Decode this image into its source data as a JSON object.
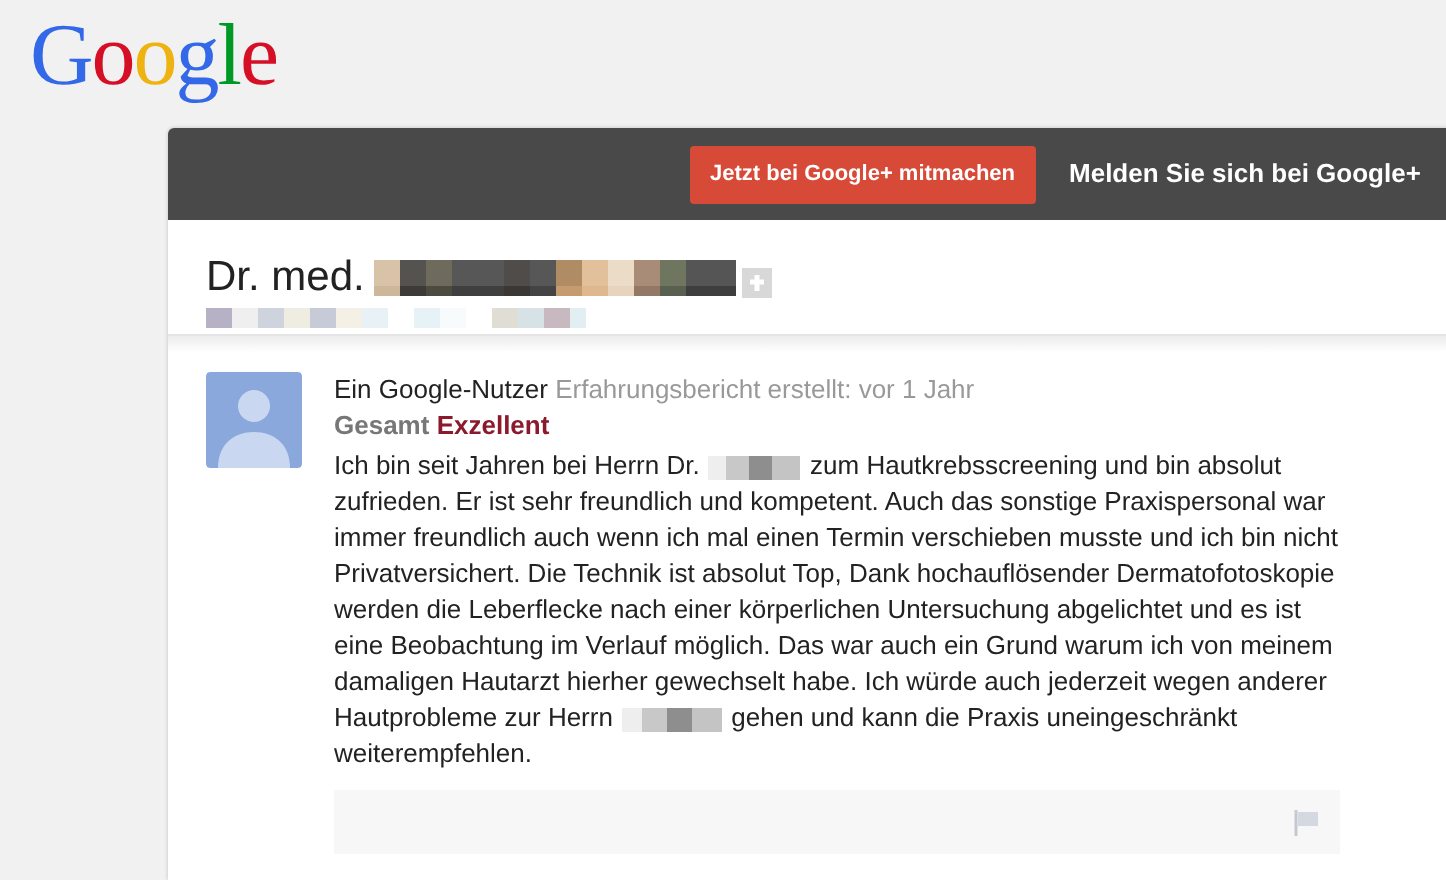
{
  "logo": "Google",
  "top_bar": {
    "join_button": "Jetzt bei Google+ mitmachen",
    "sign_in": "Melden Sie sich bei Google+"
  },
  "place": {
    "name": "Dr. med."
  },
  "review": {
    "author": "Ein Google-Nutzer",
    "meta": "Erfahrungsbericht erstellt: vor 1 Jahr",
    "rating_label": "Gesamt",
    "rating": "Exzellent",
    "text_parts": [
      "Ich bin seit Jahren bei Herrn Dr. ",
      " zum Hautkrebsscreening und bin absolut zufrieden. Er ist sehr freundlich und kompetent. Auch das sonstige Praxispersonal war immer freundlich auch wenn ich mal einen Termin verschieben musste und ich bin nicht Privatversichert. Die Technik ist absolut Top, Dank hochauflösender Dermatofotoskopie werden die Leberflecke nach einer körperlichen Untersuchung abgelichtet und es ist eine Beobachtung im Verlauf möglich. Das war auch ein Grund warum ich von meinem damaligen Hautarzt hierher gewechselt habe. Ich würde auch jederzeit wegen anderer Hautprobleme zur Herrn ",
      " gehen und kann die Praxis uneingeschränkt weiterempfehlen."
    ]
  }
}
